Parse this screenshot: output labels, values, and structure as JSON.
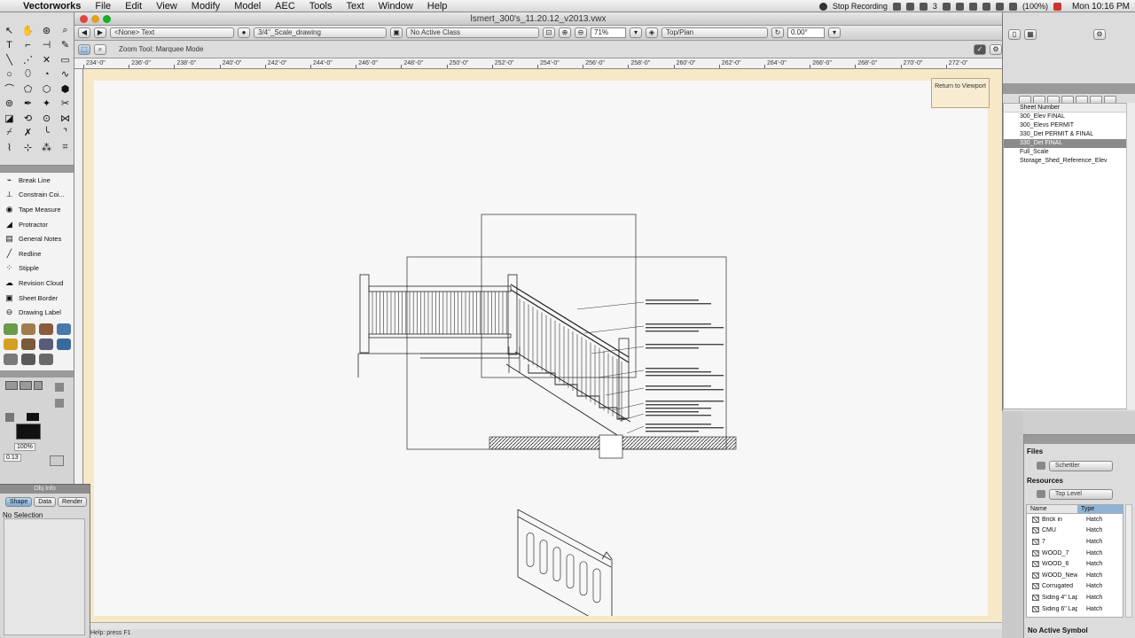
{
  "menubar": {
    "app_name": "Vectorworks",
    "items": [
      "File",
      "Edit",
      "View",
      "Modify",
      "Model",
      "AEC",
      "Tools",
      "Text",
      "Window",
      "Help"
    ],
    "status": {
      "recording": "Stop Recording",
      "badge": "3",
      "battery": "(100%)",
      "clock": "Mon 10:16 PM"
    }
  },
  "document": {
    "title": "lsmert_300's_11.20.12_v2013.vwx"
  },
  "view_bar": {
    "class_field": "<None> Text",
    "layer_field": "3/4\"_Scale_drawing",
    "active_field": "No Active Class",
    "zoom": "71%",
    "view_field": "Top/Plan",
    "rotation": "0.00°"
  },
  "mode_bar": {
    "mode_text": "Zoom Tool: Marquee Mode"
  },
  "ruler": {
    "ticks": [
      "234'-0\"",
      "236'-0\"",
      "238'-0\"",
      "240'-0\"",
      "242'-0\"",
      "244'-0\"",
      "246'-0\"",
      "248'-0\"",
      "250'-0\"",
      "252'-0\"",
      "254'-0\"",
      "256'-0\"",
      "258'-0\"",
      "260'-0\"",
      "262'-0\"",
      "264'-0\"",
      "266'-0\"",
      "268'-0\"",
      "270'-0\"",
      "272'-0\""
    ]
  },
  "canvas": {
    "return_button": "Return to Viewport"
  },
  "status_bar": {
    "text": "Help: press F1"
  },
  "toolset": {
    "items": [
      {
        "icon": "break-line-icon",
        "label": "Break Line"
      },
      {
        "icon": "constrain-icon",
        "label": "Constrain Coi..."
      },
      {
        "icon": "tape-measure-icon",
        "label": "Tape Measure"
      },
      {
        "icon": "protractor-icon",
        "label": "Protractor"
      },
      {
        "icon": "general-notes-icon",
        "label": "General Notes"
      },
      {
        "icon": "redline-icon",
        "label": "Redline"
      },
      {
        "icon": "stipple-icon",
        "label": "Stipple"
      },
      {
        "icon": "revision-cloud-icon",
        "label": "Revision Cloud"
      },
      {
        "icon": "sheet-border-icon",
        "label": "Sheet Border"
      },
      {
        "icon": "drawing-label-icon",
        "label": "Drawing Label"
      }
    ]
  },
  "attributes": {
    "opacity": "100%",
    "line_weight": "0.13"
  },
  "object_info": {
    "title": "Obj Info",
    "tabs": [
      "Shape",
      "Data",
      "Render"
    ],
    "active_tab": "Shape",
    "selection": "No Selection"
  },
  "navigation": {
    "column_header": "Sheet Number",
    "items": [
      "300_Elev FINAL",
      "300_Elevs PERMIT",
      "330_Det PERMIT & FINAL",
      "330_Det FINAL",
      "Full_Scale",
      "Storage_Shed_Reference_Elev"
    ],
    "selected_index": 3
  },
  "resource_browser": {
    "files_label": "Files",
    "file_select": "Schettler",
    "resources_label": "Resources",
    "level_select": "Top Level",
    "col_name": "Name",
    "col_type": "Type",
    "rows": [
      {
        "name": "Brick in",
        "type": "Hatch"
      },
      {
        "name": "CMU",
        "type": "Hatch"
      },
      {
        "name": "7",
        "type": "Hatch"
      },
      {
        "name": "WOOD_7",
        "type": "Hatch"
      },
      {
        "name": "WOOD_6",
        "type": "Hatch"
      },
      {
        "name": "WOOD_New...",
        "type": "Hatch"
      },
      {
        "name": "Corrugated",
        "type": "Hatch"
      },
      {
        "name": "Siding 4\" Lap",
        "type": "Hatch"
      },
      {
        "name": "Siding 6\" Lap",
        "type": "Hatch"
      }
    ],
    "footer": "No Active Symbol"
  },
  "colors": {
    "accent_selection": "#8a8a8a",
    "page_border": "#f7e8c8",
    "tab_active": "#7aa8d4"
  }
}
